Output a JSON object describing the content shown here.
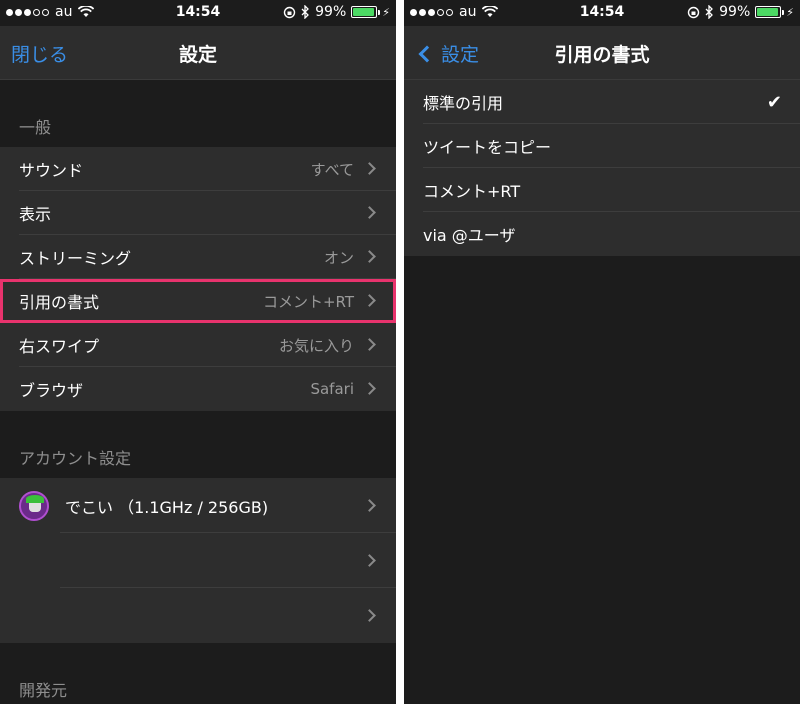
{
  "left": {
    "status": {
      "carrier": "au",
      "time": "14:54",
      "battery": "99%"
    },
    "nav": {
      "left_label": "閉じる",
      "title": "設定"
    },
    "general": {
      "header": "一般",
      "items": [
        {
          "label": "サウンド",
          "value": "すべて"
        },
        {
          "label": "表示",
          "value": ""
        },
        {
          "label": "ストリーミング",
          "value": "オン"
        },
        {
          "label": "引用の書式",
          "value": "コメント+RT"
        },
        {
          "label": "右スワイプ",
          "value": "お気に入り"
        },
        {
          "label": "ブラウザ",
          "value": "Safari"
        }
      ]
    },
    "accounts": {
      "header": "アカウント設定",
      "items": [
        {
          "label": "でこい （1.1GHz / 256GB)"
        },
        {
          "label": ""
        },
        {
          "label": ""
        }
      ]
    },
    "developer": {
      "header": "開発元"
    }
  },
  "right": {
    "status": {
      "carrier": "au",
      "time": "14:54",
      "battery": "99%"
    },
    "nav": {
      "back_label": "設定",
      "title": "引用の書式"
    },
    "options": [
      {
        "label": "標準の引用",
        "checked": true
      },
      {
        "label": "ツイートをコピー",
        "checked": false
      },
      {
        "label": "コメント+RT",
        "checked": false
      },
      {
        "label": "via @ユーザ",
        "checked": false
      }
    ],
    "check_glyph": "✔"
  },
  "colors": {
    "accent": "#3a8ee6",
    "highlight": "#e8336d",
    "battery": "#4cd964"
  }
}
